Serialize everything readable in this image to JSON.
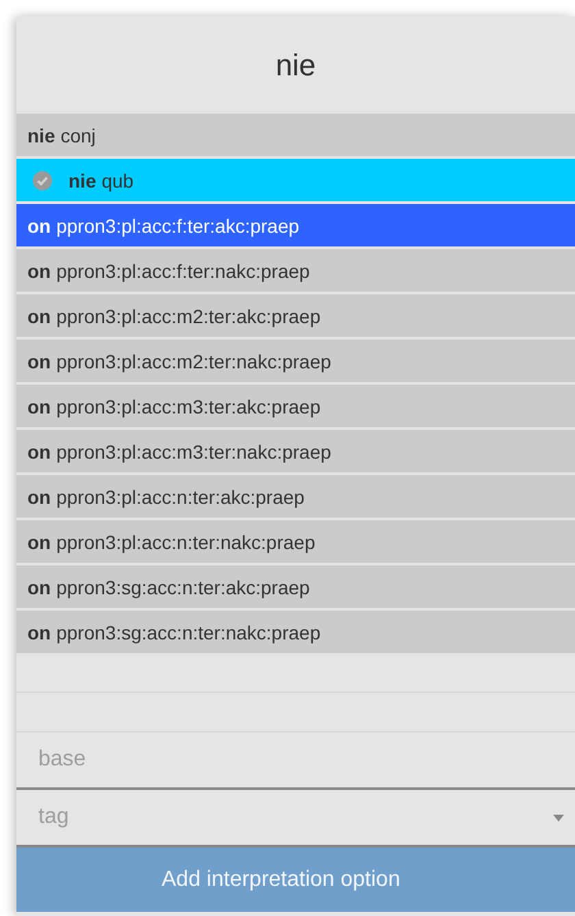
{
  "title": "nie",
  "options": [
    {
      "base": "nie",
      "tag": "conj",
      "checked": false,
      "selected": false
    },
    {
      "base": "nie",
      "tag": "qub",
      "checked": true,
      "selected": false
    },
    {
      "base": "on",
      "tag": "ppron3:pl:acc:f:ter:akc:praep",
      "checked": false,
      "selected": true
    },
    {
      "base": "on",
      "tag": "ppron3:pl:acc:f:ter:nakc:praep",
      "checked": false,
      "selected": false
    },
    {
      "base": "on",
      "tag": "ppron3:pl:acc:m2:ter:akc:praep",
      "checked": false,
      "selected": false
    },
    {
      "base": "on",
      "tag": "ppron3:pl:acc:m2:ter:nakc:praep",
      "checked": false,
      "selected": false
    },
    {
      "base": "on",
      "tag": "ppron3:pl:acc:m3:ter:akc:praep",
      "checked": false,
      "selected": false
    },
    {
      "base": "on",
      "tag": "ppron3:pl:acc:m3:ter:nakc:praep",
      "checked": false,
      "selected": false
    },
    {
      "base": "on",
      "tag": "ppron3:pl:acc:n:ter:akc:praep",
      "checked": false,
      "selected": false
    },
    {
      "base": "on",
      "tag": "ppron3:pl:acc:n:ter:nakc:praep",
      "checked": false,
      "selected": false
    },
    {
      "base": "on",
      "tag": "ppron3:sg:acc:n:ter:akc:praep",
      "checked": false,
      "selected": false
    },
    {
      "base": "on",
      "tag": "ppron3:sg:acc:n:ter:nakc:praep",
      "checked": false,
      "selected": false
    }
  ],
  "base_field": {
    "placeholder": "base"
  },
  "tag_field": {
    "placeholder": "tag"
  },
  "add_button": "Add interpretation option"
}
